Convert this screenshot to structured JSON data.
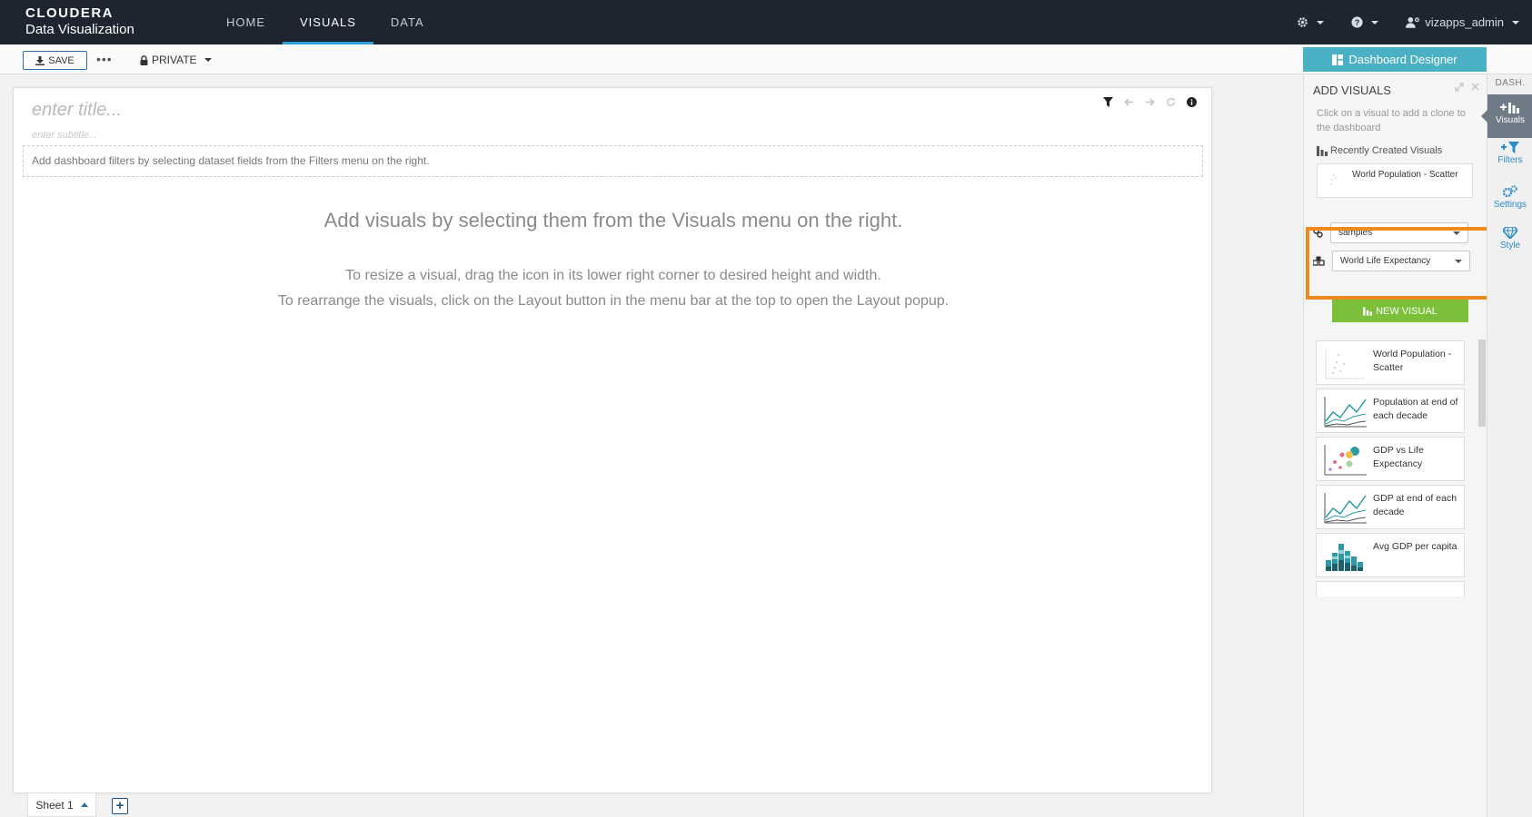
{
  "app": {
    "brand": "CLOUDERA",
    "product": "Data Visualization"
  },
  "nav": {
    "items": [
      "HOME",
      "VISUALS",
      "DATA"
    ],
    "active": "VISUALS"
  },
  "topright": {
    "user": "vizapps_admin"
  },
  "toolbar": {
    "save_label": "SAVE",
    "more_label": "•••",
    "privacy_label": "PRIVATE",
    "designer_label": "Dashboard Designer"
  },
  "canvas": {
    "title_placeholder": "enter title...",
    "subtitle_placeholder": "enter subtitle...",
    "filter_hint": "Add dashboard filters by selecting dataset fields from the Filters menu on the right.",
    "msg_main": "Add visuals by selecting them from the Visuals menu on the right.",
    "msg_resize": "To resize a visual, drag the icon in its lower right corner to desired height and width.",
    "msg_rearrange": "To rearrange the visuals, click on the Layout button in the menu bar at the top to open the Layout popup."
  },
  "sheet": {
    "tab_label": "Sheet 1",
    "add_label": "+"
  },
  "panel": {
    "title": "ADD VISUALS",
    "hint": "Click on a visual to add a clone to the dashboard",
    "recent_label": "Recently Created Visuals",
    "recent_item": "World Population - Scatter",
    "connection": "samples",
    "dataset": "World Life Expectancy",
    "new_visual_label": "NEW VISUAL",
    "visuals": [
      {
        "label": "World Population - Scatter"
      },
      {
        "label": "Population at end of each decade"
      },
      {
        "label": "GDP vs Life Expectancy"
      },
      {
        "label": "GDP at end of each decade"
      },
      {
        "label": "Avg GDP per capita"
      }
    ]
  },
  "rail": {
    "dash_label": "DASH.",
    "items": [
      "Visuals",
      "Filters",
      "Settings",
      "Style"
    ]
  },
  "colors": {
    "accent": "#2b9fd9",
    "designer": "#4ab0c4",
    "new_visual": "#7cc03a",
    "highlight": "#f08a1d",
    "topbar": "#1d2630"
  }
}
